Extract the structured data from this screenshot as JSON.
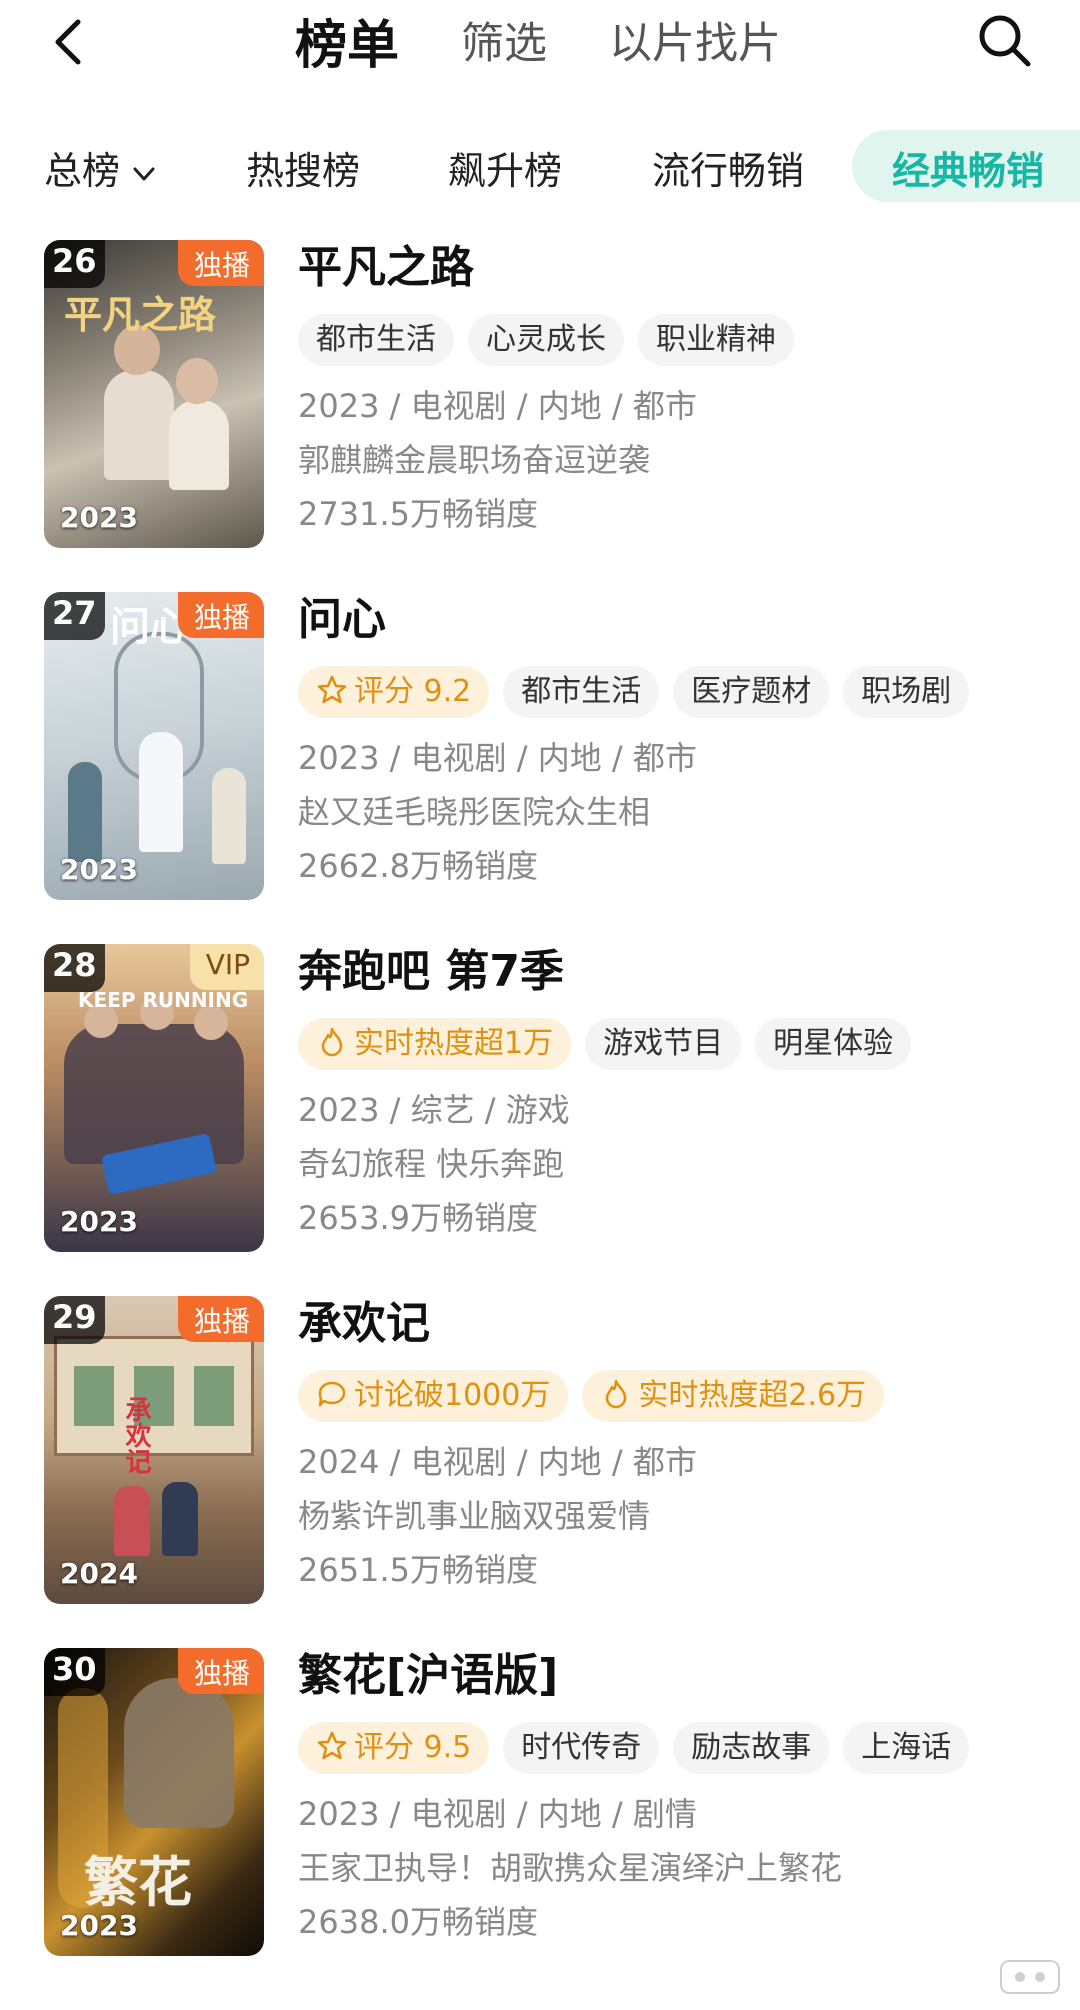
{
  "header": {
    "tabs": [
      {
        "label": "榜单",
        "active": true
      },
      {
        "label": "筛选",
        "active": false
      },
      {
        "label": "以片找片",
        "active": false
      }
    ],
    "back_icon": "back-arrow-icon",
    "search_icon": "search-icon"
  },
  "categories": [
    {
      "label": "总榜",
      "dropdown": true
    },
    {
      "label": "热搜榜"
    },
    {
      "label": "飙升榜"
    },
    {
      "label": "流行畅销"
    },
    {
      "label": "经典畅销",
      "selected": true
    }
  ],
  "colors": {
    "accent": "#16b7a4",
    "accent_bg": "#dff5ee",
    "exclusive_badge": "#f46c2b",
    "vip_badge": "#f7e1a8",
    "hot_tag_text": "#e2900f",
    "hot_tag_bg": "#fdf1dc"
  },
  "items": [
    {
      "rank": "26",
      "badge": "独播",
      "badge_type": "exclusive",
      "poster_year": "2023",
      "poster_text": "平凡之路",
      "title": "平凡之路",
      "tags": [
        {
          "label": "都市生活"
        },
        {
          "label": "心灵成长"
        },
        {
          "label": "职业精神"
        }
      ],
      "meta": "2023 / 电视剧 / 内地 / 都市",
      "desc": "郭麒麟金晨职场奋逗逆袭",
      "sales": "2731.5万畅销度"
    },
    {
      "rank": "27",
      "badge": "独播",
      "badge_type": "exclusive",
      "poster_year": "2023",
      "poster_text": "问心",
      "title": "问心",
      "tags": [
        {
          "label": "评分 9.2",
          "hot": true,
          "icon": "star-icon"
        },
        {
          "label": "都市生活"
        },
        {
          "label": "医疗题材"
        },
        {
          "label": "职场剧"
        }
      ],
      "meta": "2023 / 电视剧 / 内地 / 都市",
      "desc": "赵又廷毛晓彤医院众生相",
      "sales": "2662.8万畅销度"
    },
    {
      "rank": "28",
      "badge": "VIP",
      "badge_type": "vip",
      "poster_year": "2023",
      "poster_text": "KEEP RUNNING",
      "title": "奔跑吧 第7季",
      "tags": [
        {
          "label": "实时热度超1万",
          "hot": true,
          "icon": "flame-icon"
        },
        {
          "label": "游戏节目"
        },
        {
          "label": "明星体验"
        }
      ],
      "meta": "2023 / 综艺 / 游戏",
      "desc": "奇幻旅程 快乐奔跑",
      "sales": "2653.9万畅销度"
    },
    {
      "rank": "29",
      "badge": "独播",
      "badge_type": "exclusive",
      "poster_year": "2024",
      "poster_text": "承欢记",
      "title": "承欢记",
      "tags": [
        {
          "label": "讨论破1000万",
          "hot": true,
          "icon": "comment-icon"
        },
        {
          "label": "实时热度超2.6万",
          "hot": true,
          "icon": "flame-icon"
        }
      ],
      "meta": "2024 / 电视剧 / 内地 / 都市",
      "desc": "杨紫许凯事业脑双强爱情",
      "sales": "2651.5万畅销度"
    },
    {
      "rank": "30",
      "badge": "独播",
      "badge_type": "exclusive",
      "poster_year": "2023",
      "poster_text": "繁花",
      "title": "繁花[沪语版]",
      "tags": [
        {
          "label": "评分 9.5",
          "hot": true,
          "icon": "star-icon"
        },
        {
          "label": "时代传奇"
        },
        {
          "label": "励志故事"
        },
        {
          "label": "上海话"
        }
      ],
      "meta": "2023 / 电视剧 / 内地 / 剧情",
      "desc": "王家卫执导！胡歌携众星演绎沪上繁花",
      "sales": "2638.0万畅销度"
    }
  ]
}
